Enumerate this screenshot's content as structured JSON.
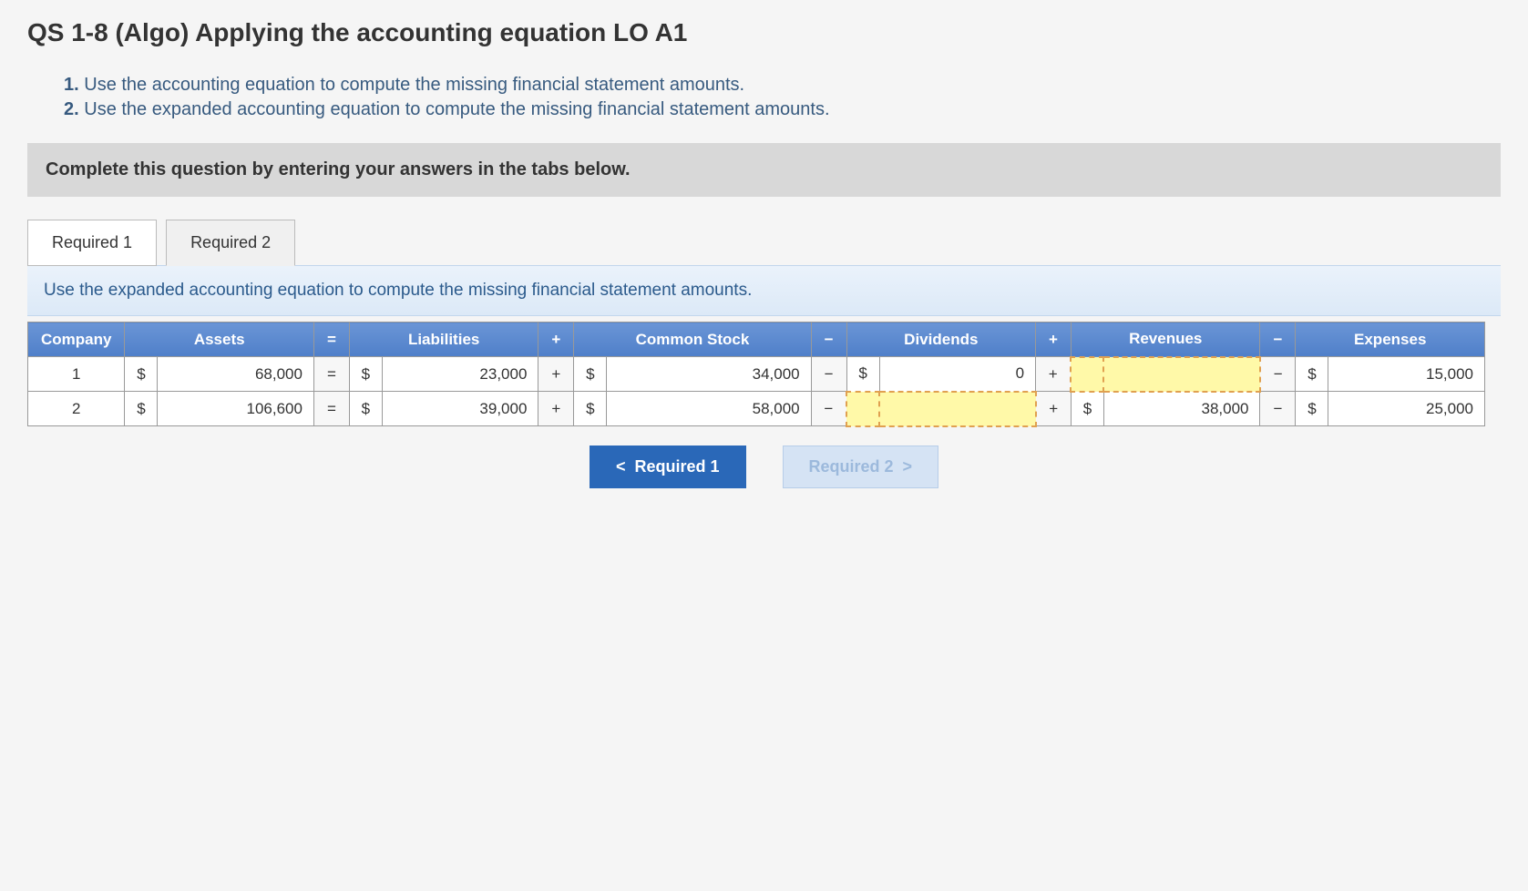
{
  "title": "QS 1-8 (Algo) Applying the accounting equation LO A1",
  "instructions": [
    "Use the accounting equation to compute the missing financial statement amounts.",
    "Use the expanded accounting equation to compute the missing financial statement amounts."
  ],
  "complete_text": "Complete this question by entering your answers in the tabs below.",
  "tabs": {
    "tab1": "Required 1",
    "tab2": "Required 2"
  },
  "tab_description": "Use the expanded accounting equation to compute the missing financial statement amounts.",
  "headers": {
    "company": "Company",
    "assets": "Assets",
    "liabilities": "Liabilities",
    "common_stock": "Common Stock",
    "dividends": "Dividends",
    "revenues": "Revenues",
    "expenses": "Expenses"
  },
  "ops": {
    "eq": "=",
    "plus": "+",
    "minus": "−"
  },
  "currency": "$",
  "rows": [
    {
      "company": "1",
      "assets": "68,000",
      "liabilities": "23,000",
      "common_stock": "34,000",
      "dividends": "0",
      "revenues": "",
      "expenses": "15,000",
      "missing": "revenues"
    },
    {
      "company": "2",
      "assets": "106,600",
      "liabilities": "39,000",
      "common_stock": "58,000",
      "dividends": "",
      "revenues": "38,000",
      "expenses": "25,000",
      "missing": "dividends"
    }
  ],
  "nav": {
    "prev": "Required 1",
    "next": "Required 2"
  },
  "chart_data": {
    "type": "table",
    "title": "Expanded Accounting Equation",
    "columns": [
      "Company",
      "Assets",
      "Liabilities",
      "Common Stock",
      "Dividends",
      "Revenues",
      "Expenses"
    ],
    "rows": [
      {
        "Company": 1,
        "Assets": 68000,
        "Liabilities": 23000,
        "Common Stock": 34000,
        "Dividends": 0,
        "Revenues": null,
        "Expenses": 15000
      },
      {
        "Company": 2,
        "Assets": 106600,
        "Liabilities": 39000,
        "Common Stock": 58000,
        "Dividends": null,
        "Revenues": 38000,
        "Expenses": 25000
      }
    ],
    "equation": "Assets = Liabilities + Common Stock - Dividends + Revenues - Expenses"
  }
}
